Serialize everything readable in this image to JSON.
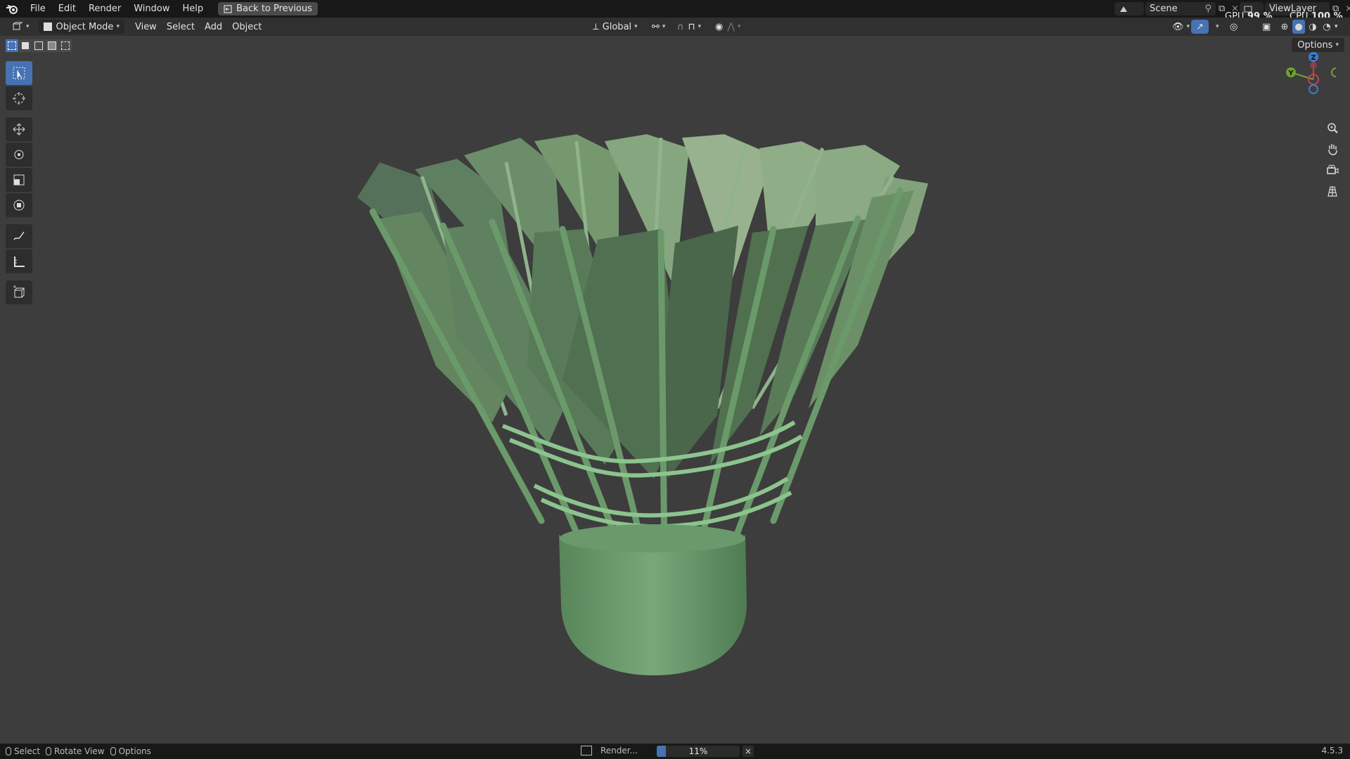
{
  "menubar": {
    "items": [
      "File",
      "Edit",
      "Render",
      "Window",
      "Help"
    ],
    "back_button": "Back to Previous",
    "scene": "Scene",
    "view_layer": "ViewLayer",
    "gpu_label": "GPU",
    "gpu_value": "99 %",
    "cpu_label": "CPU",
    "cpu_value": "100 %"
  },
  "header": {
    "mode": "Object Mode",
    "menus": [
      "View",
      "Select",
      "Add",
      "Object"
    ],
    "orientation": "Global"
  },
  "viewport": {
    "options_label": "Options",
    "gizmo": {
      "z": "Z",
      "y": "Y"
    },
    "model_color": "#6a9a6c"
  },
  "statusbar": {
    "select": "Select",
    "rotate_view": "Rotate View",
    "options": "Options",
    "render_label": "Render...",
    "progress_percent": 11,
    "progress_text": "11%",
    "version": "4.5.3"
  },
  "colors": {
    "accent": "#4772b3",
    "background": "#3d3d3d",
    "topbar": "#181818"
  }
}
